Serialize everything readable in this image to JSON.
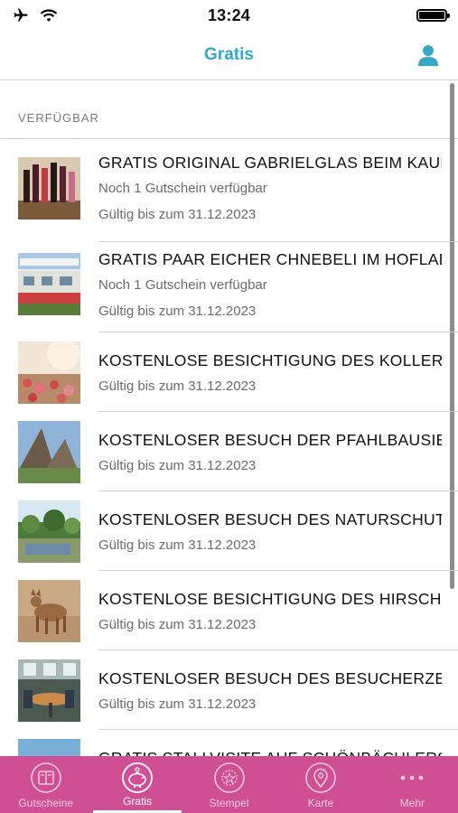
{
  "status": {
    "time": "13:24"
  },
  "nav": {
    "title": "Gratis"
  },
  "section": {
    "label": "VERFÜGBAR"
  },
  "items": [
    {
      "title": "Gratis Original Gabrielglas beim Kauf",
      "availability": "Noch 1 Gutschein verfügbar",
      "valid": "Gültig bis zum 31.12.2023"
    },
    {
      "title": "Gratis Paar Eicher Chnebeli im Hoflad",
      "availability": "Noch 1 Gutschein verfügbar",
      "valid": "Gültig bis zum 31.12.2023"
    },
    {
      "title": "Kostenlose Besichtigung des Kollerh",
      "valid": "Gültig bis zum 31.12.2023"
    },
    {
      "title": "Kostenloser Besuch der Pfahlbausiedlung",
      "valid": "Gültig bis zum 31.12.2023"
    },
    {
      "title": "Kostenloser Besuch des Naturschutz",
      "valid": "Gültig bis zum 31.12.2023"
    },
    {
      "title": "Kostenlose Besichtigung des Hirschp.",
      "valid": "Gültig bis zum 31.12.2023"
    },
    {
      "title": "Kostenloser Besuch des Besucherzen",
      "valid": "Gültig bis zum 31.12.2023"
    },
    {
      "title": "Gratis Stallvisite auf Schönbächlers"
    }
  ],
  "tabs": [
    {
      "label": "Gutscheine",
      "icon": "coupon-book-icon"
    },
    {
      "label": "Gratis",
      "icon": "piggy-bank-icon",
      "active": true
    },
    {
      "label": "Stempel",
      "icon": "stamp-icon"
    },
    {
      "label": "Karte",
      "icon": "map-pin-icon"
    },
    {
      "label": "Mehr",
      "icon": "more-dots-icon"
    }
  ],
  "colors": {
    "accent": "#35a9c4",
    "tabbar": "#cf4f94"
  }
}
